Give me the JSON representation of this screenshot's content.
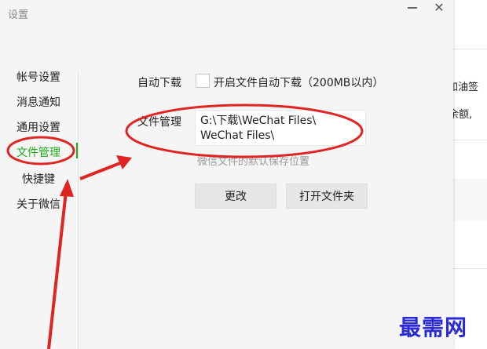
{
  "window": {
    "title": "设置"
  },
  "sidebar": {
    "items": [
      {
        "label": "帐号设置"
      },
      {
        "label": "消息通知"
      },
      {
        "label": "通用设置"
      },
      {
        "label": "文件管理",
        "active": true
      },
      {
        "label": "快捷键"
      },
      {
        "label": "关于微信"
      }
    ]
  },
  "download": {
    "label": "自动下载",
    "checkbox_label": "开启文件自动下载（200MB以内）",
    "checked": false
  },
  "file_manage": {
    "label": "文件管理",
    "path_line1": "G:\\下载\\WeChat Files\\",
    "path_line2": "WeChat Files\\",
    "hint": "微信文件的默认保存位置",
    "change_button": "更改",
    "open_folder_button": "打开文件夹"
  },
  "background": {
    "fragment1": "加油签",
    "fragment2": "余额,"
  },
  "watermark": "最需网",
  "colors": {
    "accent_green": "#1aad19",
    "annotation_red": "#e02424",
    "watermark_blue": "#2b2bd6"
  }
}
